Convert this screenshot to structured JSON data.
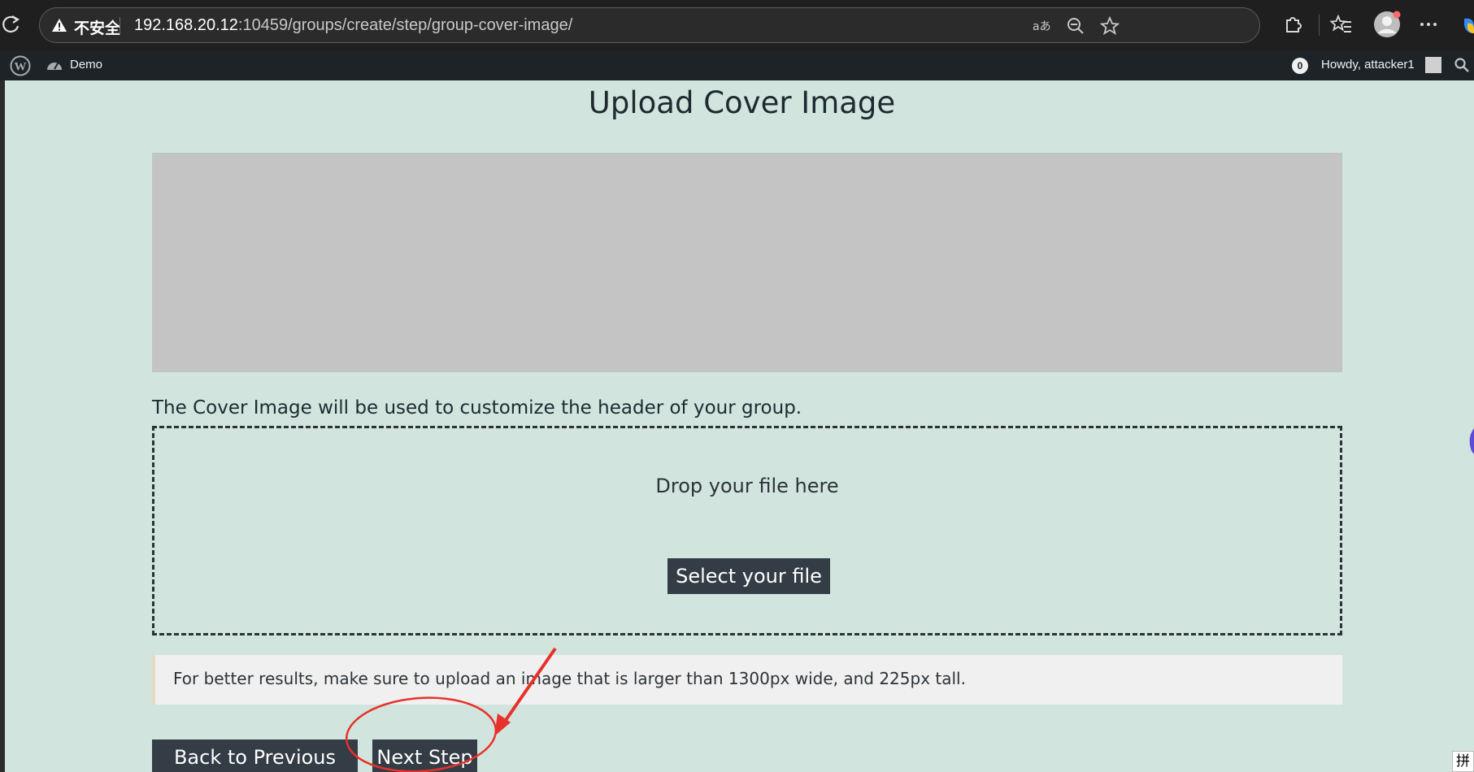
{
  "browser": {
    "insecure_label": "不安全",
    "url_host": "192.168.20.12",
    "url_rest": ":10459/groups/create/step/group-cover-image/",
    "icons": [
      "reload-icon",
      "warning-icon",
      "read-aloud-icon",
      "zoom-out-icon",
      "favorite-star-icon",
      "extensions-icon",
      "favorites-icon",
      "profile-icon",
      "more-icon"
    ]
  },
  "admin_bar": {
    "site_name": "Demo",
    "notification_count": "0",
    "howdy": "Howdy, attacker1"
  },
  "page": {
    "title": "Upload Cover Image",
    "cover_description": "The Cover Image will be used to customize the header of your group.",
    "dropzone_text": "Drop your file here",
    "select_button": "Select your file",
    "notice": "For better results, make sure to upload an image that is larger than 1300px wide, and 225px tall.",
    "back_button": "Back to Previous Step",
    "next_button": "Next Step"
  },
  "annotation": {
    "color": "#e8312a",
    "target": "next-button"
  },
  "colors": {
    "page_bg": "#d1e4de",
    "button_bg": "#343d46",
    "preview_bg": "#c4c4c4",
    "admin_bar_bg": "#1d2327"
  },
  "ime_indicator": "拼"
}
